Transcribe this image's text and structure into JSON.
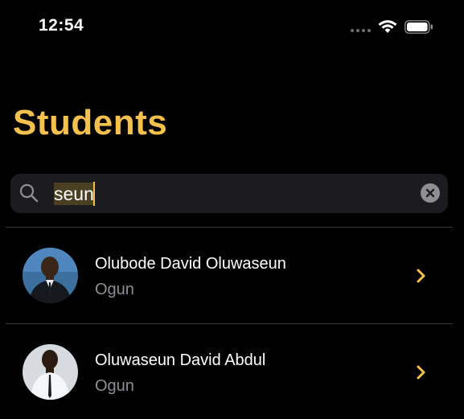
{
  "status_bar": {
    "time": "12:54"
  },
  "page": {
    "title": "Students"
  },
  "search": {
    "value": "seun"
  },
  "students": [
    {
      "name": "Olubode David Oluwaseun",
      "region": "Ogun"
    },
    {
      "name": "Oluwaseun David Abdul",
      "region": "Ogun"
    }
  ],
  "colors": {
    "accent": "#f5c14e",
    "background": "#000000",
    "search_bg": "#1c1c1e",
    "secondary_text": "#8e8e93"
  },
  "icons": [
    "signal-icon",
    "wifi-icon",
    "battery-icon",
    "search-icon",
    "clear-icon",
    "chevron-right-icon"
  ]
}
